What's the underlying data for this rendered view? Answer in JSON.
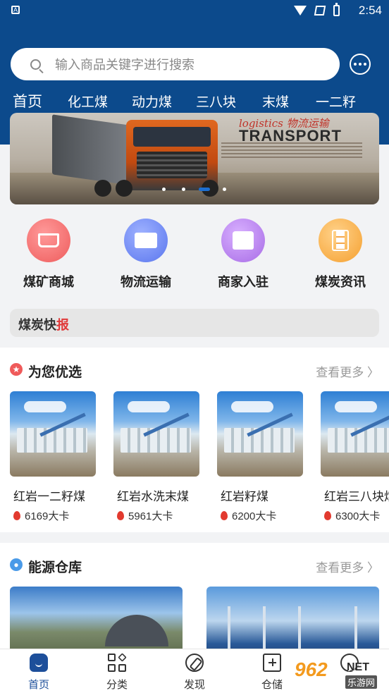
{
  "status_bar": {
    "app_glyph": "A",
    "time": "2:54"
  },
  "search": {
    "placeholder": "输入商品关键字进行搜索"
  },
  "tabs": [
    {
      "label": "首页",
      "active": true
    },
    {
      "label": "化工煤",
      "active": false
    },
    {
      "label": "动力煤",
      "active": false
    },
    {
      "label": "三八块",
      "active": false
    },
    {
      "label": "末煤",
      "active": false
    },
    {
      "label": "一二籽",
      "active": false
    }
  ],
  "banner": {
    "title_script": "logistics 物流运输",
    "title_main": "TRANSPORT",
    "dots_count": 4,
    "active_dot": 2
  },
  "menu": [
    {
      "label": "煤矿商城",
      "icon": "cart-icon",
      "color": "#f06a6a"
    },
    {
      "label": "物流运输",
      "icon": "truck-icon",
      "color": "#5f7ef0"
    },
    {
      "label": "商家入驻",
      "icon": "shop-icon",
      "color": "#b57ae8"
    },
    {
      "label": "煤炭资讯",
      "icon": "document-icon",
      "color": "#f5a83e"
    }
  ],
  "news": {
    "title_pre": "煤炭快",
    "title_post": "报"
  },
  "recommend": {
    "title": "为您优选",
    "more": "查看更多 〉",
    "products": [
      {
        "name": "红岩一二籽煤",
        "calorie": "6169大卡"
      },
      {
        "name": "红岩水洗末煤",
        "calorie": "5961大卡"
      },
      {
        "name": "红岩籽煤",
        "calorie": "6200大卡"
      },
      {
        "name": "红岩三八块煤",
        "calorie": "6300大卡"
      }
    ]
  },
  "warehouse": {
    "title": "能源仓库",
    "more": "查看更多 〉"
  },
  "bottom_nav": [
    {
      "label": "首页",
      "active": true
    },
    {
      "label": "分类",
      "active": false
    },
    {
      "label": "发现",
      "active": false
    },
    {
      "label": "仓储",
      "active": false
    }
  ],
  "watermark": {
    "logo": "962",
    "net": "NET",
    "sub": "乐游网"
  },
  "colors": {
    "header": "#0c4a8c",
    "accent": "#1d4f9a",
    "flame": "#e23a2f"
  }
}
